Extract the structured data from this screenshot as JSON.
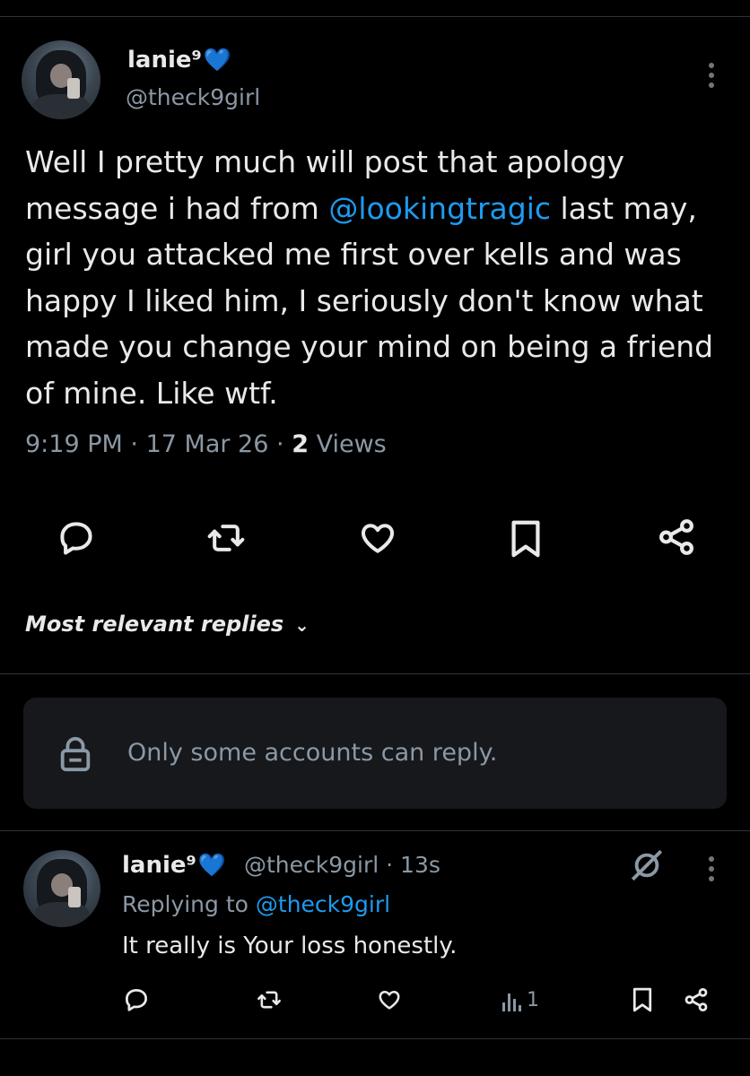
{
  "tweet": {
    "author_name": "lanie⁹",
    "author_handle": "@theck9girl",
    "text_parts": [
      "Well I pretty much will post that apology message i had from ",
      "@lookingtragic",
      " last may, girl you attacked me first over kells and was happy I liked him, I seriously don't know what made you change your mind on being a friend of mine. Like wtf."
    ],
    "time": "9:19 PM",
    "date": "17 Mar 26",
    "views_count": "2",
    "views_label": "Views",
    "separator": "·"
  },
  "icons": {
    "heart_badge": "💙",
    "reply": "reply-icon",
    "repost": "repost-icon",
    "like": "heart-icon",
    "bookmark": "bookmark-icon",
    "share": "share-icon",
    "more": "more-icon",
    "lock": "lock-icon",
    "grok": "grok-icon",
    "views": "views-icon"
  },
  "replies_filter": {
    "label": "Most relevant replies",
    "chevron": "⌄"
  },
  "restriction": {
    "text": "Only some accounts can reply."
  },
  "reply": {
    "author_name": "lanie⁹",
    "handle_time": "@theck9girl · 13s",
    "replying_prefix": "Replying to ",
    "replying_handle": "@theck9girl",
    "text": "It really is Your loss honestly.",
    "views": "1"
  },
  "colors": {
    "background": "#000000",
    "text": "#e7e9ea",
    "secondary": "#8b98a5",
    "link": "#1d9bf0",
    "heart_badge": "#4fc3f7"
  }
}
